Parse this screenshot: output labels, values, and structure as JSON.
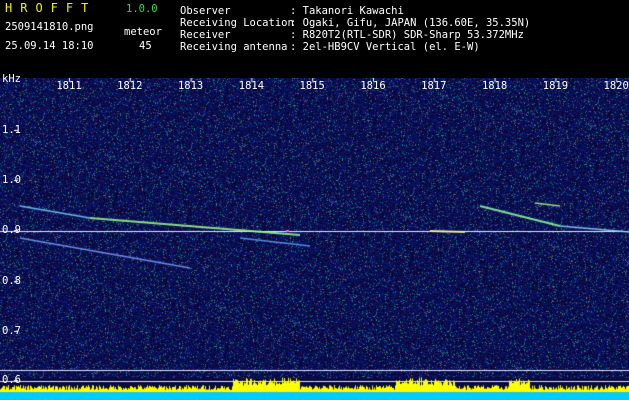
{
  "header": {
    "app_name": "HROFFT",
    "version": "1.0.0",
    "filename": "2509141810.png",
    "mode": "meteor",
    "datetime": "25.09.14 18:10",
    "count": "45",
    "info": [
      {
        "label": "Observer",
        "value": ": Takanori Kawachi"
      },
      {
        "label": "Receiving Location",
        "value": ": Ogaki, Gifu, JAPAN (136.60E, 35.35N)"
      },
      {
        "label": "Receiver",
        "value": ": R820T2(RTL-SDR) SDR-Sharp 53.372MHz"
      },
      {
        "label": "Receiving antenna",
        "value": ": 2el-HB9CV Vertical (el. E-W)"
      }
    ]
  },
  "spectrogram": {
    "unit_label": "kHz",
    "time_ticks": [
      "1811",
      "1812",
      "1813",
      "1814",
      "1815",
      "1816",
      "1817",
      "1818",
      "1819",
      "1820"
    ],
    "freq_ticks": [
      "1.1",
      "1.0",
      "0.9",
      "0.8",
      "0.7",
      "0.6"
    ],
    "colors": {
      "background": "#0a0a3c",
      "carrier": "#e8e8ff",
      "trail": "#60ff60",
      "level": "#ffff00",
      "level_base": "#00ccff"
    }
  }
}
